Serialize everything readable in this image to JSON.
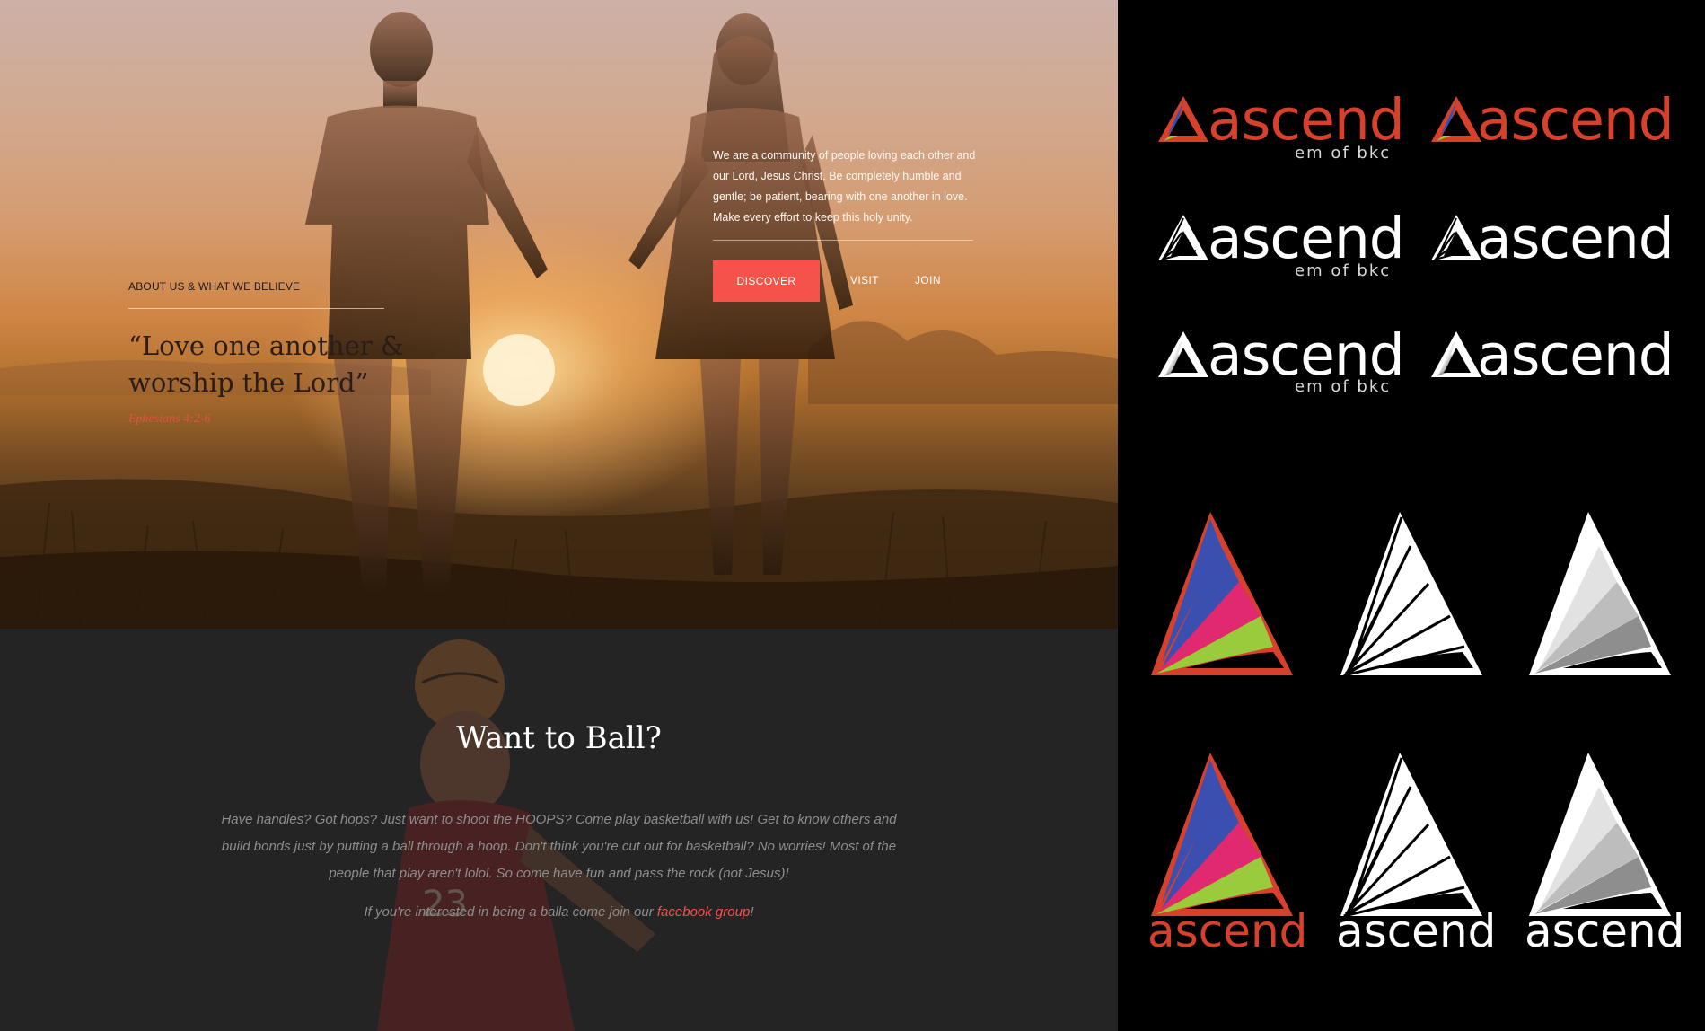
{
  "hero": {
    "about_label": "ABOUT US & WHAT WE BELIEVE",
    "quote": "“Love one another & worship the Lord”",
    "quote_reference": "Ephesians 4:2-6",
    "intro": "We are a community of people loving each other and our Lord, Jesus Christ. Be completely humble and gentle; be patient, bearing with one another in love. Make every effort to keep this holy unity.",
    "nav": {
      "discover": "DISCOVER",
      "visit": "VISIT",
      "join": "JOIN"
    },
    "colors": {
      "accent": "#f5524a"
    }
  },
  "ball": {
    "title": "Want to Ball?",
    "text": "Have handles? Got hops? Just want to shoot the HOOPS? Come play basketball with us! Get to know others and build bonds just by putting a ball through a hoop. Don't think you're cut out for basketball? No worries! Most of the people that play aren't lolol. So come have fun and pass the rock (not Jesus)!",
    "cta_prefix": "If you're interested in being a balla come join our ",
    "cta_link": "facebook group",
    "cta_suffix": "!"
  },
  "logos": {
    "wordmark": "ascend",
    "subtitle": "em of bkc",
    "colors": {
      "brand_red": "#d7412c",
      "blue": "#3b4fb0",
      "pink": "#e0296f",
      "lime": "#9acb3c"
    },
    "variants": [
      "color",
      "white",
      "gray"
    ]
  }
}
